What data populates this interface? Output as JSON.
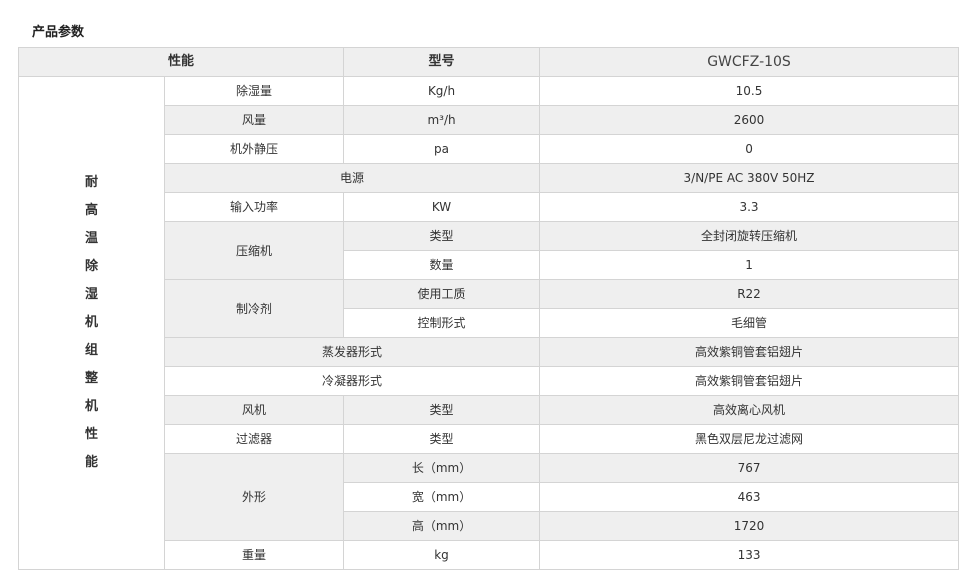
{
  "title": "产品参数",
  "header": {
    "performance": "性能",
    "model_label": "型号",
    "model_value": "GWCFZ-10S"
  },
  "category_chars": [
    "耐",
    "高",
    "温",
    "除",
    "湿",
    "机",
    "组",
    "整",
    "机",
    "性",
    "能"
  ],
  "rows": {
    "dehumid": {
      "label": "除湿量",
      "unit": "Kg/h",
      "value": "10.5"
    },
    "airflow": {
      "label": "风量",
      "unit": "m³/h",
      "value": "2600"
    },
    "static_pressure": {
      "label": "机外静压",
      "unit": "pa",
      "value": "0"
    },
    "power_supply": {
      "label": "电源",
      "value": "3/N/PE AC 380V 50HZ"
    },
    "input_power": {
      "label": "输入功率",
      "unit": "KW",
      "value": "3.3"
    },
    "compressor": {
      "label": "压缩机",
      "type_label": "类型",
      "type_value": "全封闭旋转压缩机",
      "qty_label": "数量",
      "qty_value": "1"
    },
    "refrigerant": {
      "label": "制冷剂",
      "medium_label": "使用工质",
      "medium_value": "R22",
      "control_label": "控制形式",
      "control_value": "毛细管"
    },
    "evaporator": {
      "label": "蒸发器形式",
      "value": "高效紫铜管套铝翅片"
    },
    "condenser": {
      "label": "冷凝器形式",
      "value": "高效紫铜管套铝翅片"
    },
    "fan": {
      "label": "风机",
      "type_label": "类型",
      "value": "高效离心风机"
    },
    "filter": {
      "label": "过滤器",
      "type_label": "类型",
      "value": "黑色双层尼龙过滤网"
    },
    "dimensions": {
      "label": "外形",
      "length_label": "长（mm）",
      "length_value": "767",
      "width_label": "宽（mm）",
      "width_value": "463",
      "height_label": "高（mm）",
      "height_value": "1720"
    },
    "weight": {
      "label": "重量",
      "unit": "kg",
      "value": "133"
    }
  }
}
